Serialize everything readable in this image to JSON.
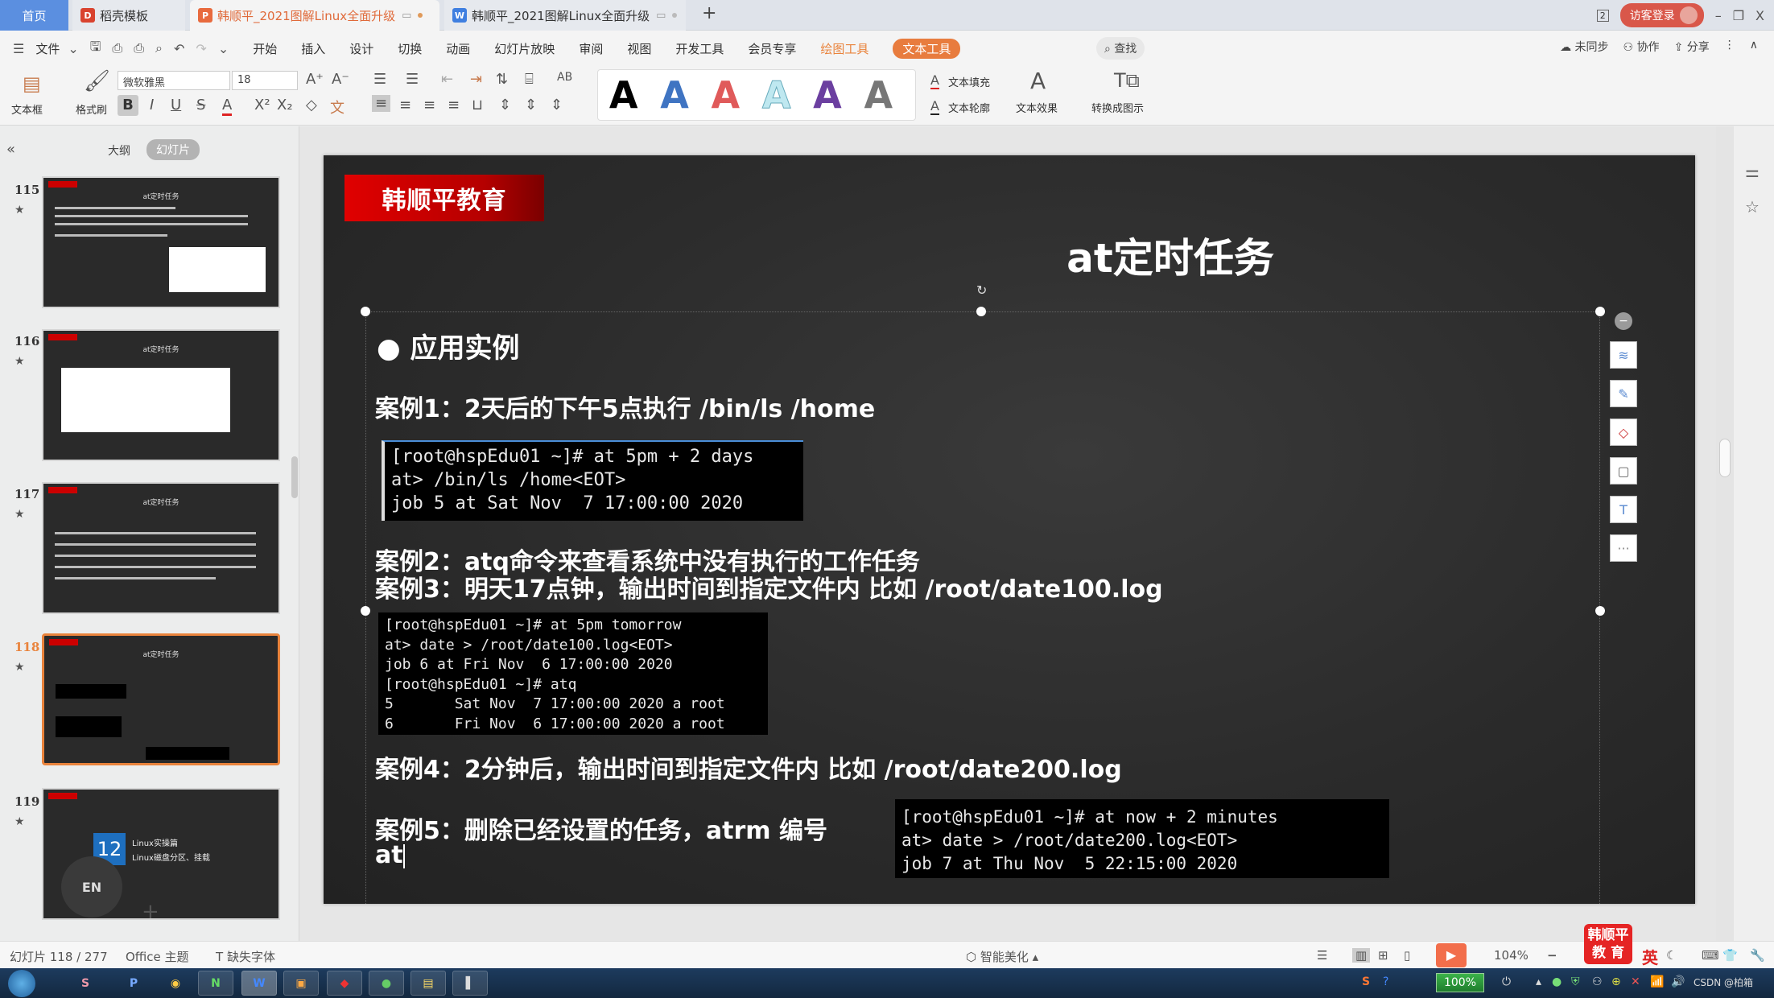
{
  "tabs": {
    "home": "首页",
    "template": "稻壳模板",
    "doc_ppt": "韩顺平_2021图解Linux全面升级",
    "doc_word": "韩顺平_2021图解Linux全面升级",
    "add": "+"
  },
  "window": {
    "badge_num": "2",
    "login": "访客登录",
    "minimize": "–",
    "restore": "❐",
    "close": "X"
  },
  "menu": {
    "file": "文件",
    "items": [
      "开始",
      "插入",
      "设计",
      "切换",
      "动画",
      "幻灯片放映",
      "审阅",
      "视图",
      "开发工具",
      "会员专享"
    ],
    "drawing_tools": "绘图工具",
    "text_tools": "文本工具",
    "find": "查找",
    "sync": "未同步",
    "collab": "协作",
    "share": "分享"
  },
  "ribbon": {
    "textbox": "文本框",
    "format_painter": "格式刷",
    "font_name": "微软雅黑",
    "font_size": "18",
    "text_fill": "文本填充",
    "text_outline": "文本轮廓",
    "text_effect": "文本效果",
    "convert_smartart": "转换成图示",
    "gallery_colors": [
      "#000000",
      "#3f74c2",
      "#e05a5a",
      "#bfe8f0",
      "#6b3fa0",
      "#777777"
    ]
  },
  "left_panel": {
    "outline_tab": "大纲",
    "slides_tab": "幻灯片",
    "slides": [
      {
        "num": "115",
        "title": "at定时任务"
      },
      {
        "num": "116",
        "title": "at定时任务"
      },
      {
        "num": "117",
        "title": "at定时任务"
      },
      {
        "num": "118",
        "title": "at定时任务",
        "selected": true
      },
      {
        "num": "119",
        "chapter_num": "12",
        "chapter_line1": "Linux实操篇",
        "chapter_line2": "Linux磁盘分区、挂载"
      }
    ],
    "en_bubble": "EN"
  },
  "slide": {
    "brand": "韩顺平教育",
    "title": "at定时任务",
    "section": "应用实例",
    "case1": "案例1：2天后的下午5点执行 /bin/ls /home",
    "term1": [
      "[root@hspEdu01 ~]# at 5pm + 2 days",
      "at> /bin/ls /home<EOT>",
      "job 5 at Sat Nov  7 17:00:00 2020"
    ],
    "case2": "案例2：atq命令来查看系统中没有执行的工作任务",
    "case3": "案例3：明天17点钟，输出时间到指定文件内 比如 /root/date100.log",
    "term2": [
      "[root@hspEdu01 ~]# at 5pm tomorrow",
      "at> date > /root/date100.log<EOT>",
      "job 6 at Fri Nov  6 17:00:00 2020",
      "[root@hspEdu01 ~]# atq",
      "5       Sat Nov  7 17:00:00 2020 a root",
      "6       Fri Nov  6 17:00:00 2020 a root"
    ],
    "case4": "案例4：2分钟后，输出时间到指定文件内 比如 /root/date200.log",
    "case5": "案例5：删除已经设置的任务，atrm 编号",
    "case5_typing": "at",
    "term3": [
      "[root@hspEdu01 ~]# at now + 2 minutes",
      "at> date > /root/date200.log<EOT>",
      "job 7 at Thu Nov  5 22:15:00 2020"
    ]
  },
  "statusbar": {
    "slide_pos": "幻灯片 118 / 277",
    "theme": "Office 主题",
    "missing_font": "缺失字体",
    "smart_beautify": "智能美化",
    "zoom": "104%",
    "logo_line1": "韩顺平",
    "logo_line2": "教 育",
    "ime": "英"
  },
  "taskbar": {
    "battery": "100%",
    "watermark": "CSDN @柏箱"
  }
}
